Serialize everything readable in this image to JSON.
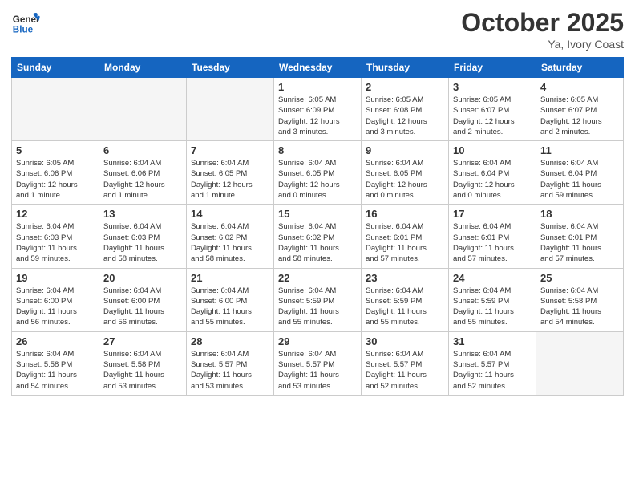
{
  "header": {
    "logo_general": "General",
    "logo_blue": "Blue",
    "month": "October 2025",
    "location": "Ya, Ivory Coast"
  },
  "weekdays": [
    "Sunday",
    "Monday",
    "Tuesday",
    "Wednesday",
    "Thursday",
    "Friday",
    "Saturday"
  ],
  "weeks": [
    [
      {
        "day": "",
        "info": ""
      },
      {
        "day": "",
        "info": ""
      },
      {
        "day": "",
        "info": ""
      },
      {
        "day": "1",
        "info": "Sunrise: 6:05 AM\nSunset: 6:09 PM\nDaylight: 12 hours\nand 3 minutes."
      },
      {
        "day": "2",
        "info": "Sunrise: 6:05 AM\nSunset: 6:08 PM\nDaylight: 12 hours\nand 3 minutes."
      },
      {
        "day": "3",
        "info": "Sunrise: 6:05 AM\nSunset: 6:07 PM\nDaylight: 12 hours\nand 2 minutes."
      },
      {
        "day": "4",
        "info": "Sunrise: 6:05 AM\nSunset: 6:07 PM\nDaylight: 12 hours\nand 2 minutes."
      }
    ],
    [
      {
        "day": "5",
        "info": "Sunrise: 6:05 AM\nSunset: 6:06 PM\nDaylight: 12 hours\nand 1 minute."
      },
      {
        "day": "6",
        "info": "Sunrise: 6:04 AM\nSunset: 6:06 PM\nDaylight: 12 hours\nand 1 minute."
      },
      {
        "day": "7",
        "info": "Sunrise: 6:04 AM\nSunset: 6:05 PM\nDaylight: 12 hours\nand 1 minute."
      },
      {
        "day": "8",
        "info": "Sunrise: 6:04 AM\nSunset: 6:05 PM\nDaylight: 12 hours\nand 0 minutes."
      },
      {
        "day": "9",
        "info": "Sunrise: 6:04 AM\nSunset: 6:05 PM\nDaylight: 12 hours\nand 0 minutes."
      },
      {
        "day": "10",
        "info": "Sunrise: 6:04 AM\nSunset: 6:04 PM\nDaylight: 12 hours\nand 0 minutes."
      },
      {
        "day": "11",
        "info": "Sunrise: 6:04 AM\nSunset: 6:04 PM\nDaylight: 11 hours\nand 59 minutes."
      }
    ],
    [
      {
        "day": "12",
        "info": "Sunrise: 6:04 AM\nSunset: 6:03 PM\nDaylight: 11 hours\nand 59 minutes."
      },
      {
        "day": "13",
        "info": "Sunrise: 6:04 AM\nSunset: 6:03 PM\nDaylight: 11 hours\nand 58 minutes."
      },
      {
        "day": "14",
        "info": "Sunrise: 6:04 AM\nSunset: 6:02 PM\nDaylight: 11 hours\nand 58 minutes."
      },
      {
        "day": "15",
        "info": "Sunrise: 6:04 AM\nSunset: 6:02 PM\nDaylight: 11 hours\nand 58 minutes."
      },
      {
        "day": "16",
        "info": "Sunrise: 6:04 AM\nSunset: 6:01 PM\nDaylight: 11 hours\nand 57 minutes."
      },
      {
        "day": "17",
        "info": "Sunrise: 6:04 AM\nSunset: 6:01 PM\nDaylight: 11 hours\nand 57 minutes."
      },
      {
        "day": "18",
        "info": "Sunrise: 6:04 AM\nSunset: 6:01 PM\nDaylight: 11 hours\nand 57 minutes."
      }
    ],
    [
      {
        "day": "19",
        "info": "Sunrise: 6:04 AM\nSunset: 6:00 PM\nDaylight: 11 hours\nand 56 minutes."
      },
      {
        "day": "20",
        "info": "Sunrise: 6:04 AM\nSunset: 6:00 PM\nDaylight: 11 hours\nand 56 minutes."
      },
      {
        "day": "21",
        "info": "Sunrise: 6:04 AM\nSunset: 6:00 PM\nDaylight: 11 hours\nand 55 minutes."
      },
      {
        "day": "22",
        "info": "Sunrise: 6:04 AM\nSunset: 5:59 PM\nDaylight: 11 hours\nand 55 minutes."
      },
      {
        "day": "23",
        "info": "Sunrise: 6:04 AM\nSunset: 5:59 PM\nDaylight: 11 hours\nand 55 minutes."
      },
      {
        "day": "24",
        "info": "Sunrise: 6:04 AM\nSunset: 5:59 PM\nDaylight: 11 hours\nand 55 minutes."
      },
      {
        "day": "25",
        "info": "Sunrise: 6:04 AM\nSunset: 5:58 PM\nDaylight: 11 hours\nand 54 minutes."
      }
    ],
    [
      {
        "day": "26",
        "info": "Sunrise: 6:04 AM\nSunset: 5:58 PM\nDaylight: 11 hours\nand 54 minutes."
      },
      {
        "day": "27",
        "info": "Sunrise: 6:04 AM\nSunset: 5:58 PM\nDaylight: 11 hours\nand 53 minutes."
      },
      {
        "day": "28",
        "info": "Sunrise: 6:04 AM\nSunset: 5:57 PM\nDaylight: 11 hours\nand 53 minutes."
      },
      {
        "day": "29",
        "info": "Sunrise: 6:04 AM\nSunset: 5:57 PM\nDaylight: 11 hours\nand 53 minutes."
      },
      {
        "day": "30",
        "info": "Sunrise: 6:04 AM\nSunset: 5:57 PM\nDaylight: 11 hours\nand 52 minutes."
      },
      {
        "day": "31",
        "info": "Sunrise: 6:04 AM\nSunset: 5:57 PM\nDaylight: 11 hours\nand 52 minutes."
      },
      {
        "day": "",
        "info": ""
      }
    ]
  ]
}
